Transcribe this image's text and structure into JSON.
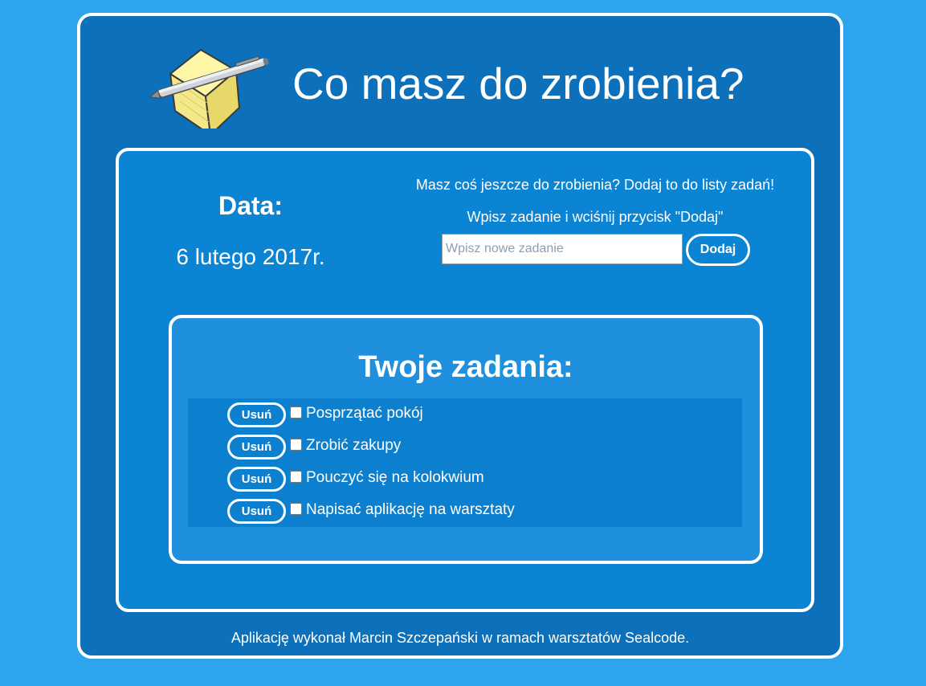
{
  "header": {
    "title": "Co masz do zrobienia?",
    "logo_icon": "notepad-pen-icon"
  },
  "date": {
    "label": "Data:",
    "value": "6 lutego 2017r."
  },
  "add_task": {
    "prompt_line_1": "Masz coś jeszcze do zrobienia? Dodaj to do listy zadań!",
    "prompt_line_2": "Wpisz zadanie i wciśnij przycisk \"Dodaj\"",
    "input_value": "",
    "input_placeholder": "Wpisz nowe zadanie",
    "button_label": "Dodaj"
  },
  "tasks": {
    "title": "Twoje zadania:",
    "remove_label": "Usuń",
    "items": [
      {
        "text": "Posprzątać pokój",
        "done": false
      },
      {
        "text": "Zrobić zakupy",
        "done": false
      },
      {
        "text": "Pouczyć się na kolokwium",
        "done": false
      },
      {
        "text": "Napisać aplikację na warsztaty",
        "done": false
      }
    ]
  },
  "footer": {
    "text": "Aplikację wykonał Marcin Szczepański w ramach warsztatów Sealcode."
  },
  "colors": {
    "page_background": "#2ea3ee",
    "app_background": "#0d70ba",
    "panel_background": "#0c84d4",
    "tasks_panel_background": "#1e90de",
    "border": "#ffffff",
    "text": "#ffffff"
  }
}
